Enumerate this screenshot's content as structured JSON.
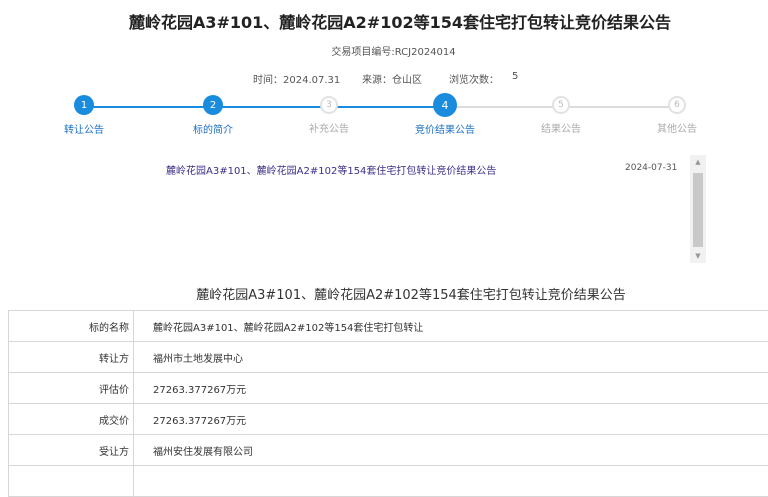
{
  "page": {
    "title": "麓岭花园A3#101、麓岭花园A2#102等154套住宅打包转让竞价结果公告",
    "project_no": "交易项目编号:RCJ2024014",
    "meta": {
      "time_label": "时间：2024.07.31",
      "source_label": "来源：仓山区",
      "views_label": "浏览次数：",
      "views_count": "5"
    }
  },
  "steps": [
    {
      "num": "1",
      "label": "转让公告",
      "state": "active"
    },
    {
      "num": "2",
      "label": "标的简介",
      "state": "active"
    },
    {
      "num": "3",
      "label": "补充公告",
      "state": "inactive"
    },
    {
      "num": "4",
      "label": "竞价结果公告",
      "state": "current"
    },
    {
      "num": "5",
      "label": "结果公告",
      "state": "inactive"
    },
    {
      "num": "6",
      "label": "其他公告",
      "state": "inactive"
    }
  ],
  "announcement_list": [
    {
      "title": "麓岭花园A3#101、麓岭花园A2#102等154套住宅打包转让竞价结果公告",
      "date": "2024-07-31"
    }
  ],
  "scroll": {
    "up_icon": "▲",
    "down_icon": "▼"
  },
  "result": {
    "heading": "麓岭花园A3#101、麓岭花园A2#102等154套住宅打包转让竞价结果公告",
    "rows": [
      {
        "label": "标的名称",
        "value": "麓岭花园A3#101、麓岭花园A2#102等154套住宅打包转让"
      },
      {
        "label": "转让方",
        "value": "福州市土地发展中心"
      },
      {
        "label": "评估价",
        "value": "27263.377267万元"
      },
      {
        "label": "成交价",
        "value": "27263.377267万元"
      },
      {
        "label": "受让方",
        "value": "福州安住发展有限公司"
      },
      {
        "label": "",
        "value": ""
      }
    ]
  },
  "colors": {
    "accent": "#1a8cde",
    "inactive": "#dcdcdc",
    "link": "#3d2f8a"
  }
}
